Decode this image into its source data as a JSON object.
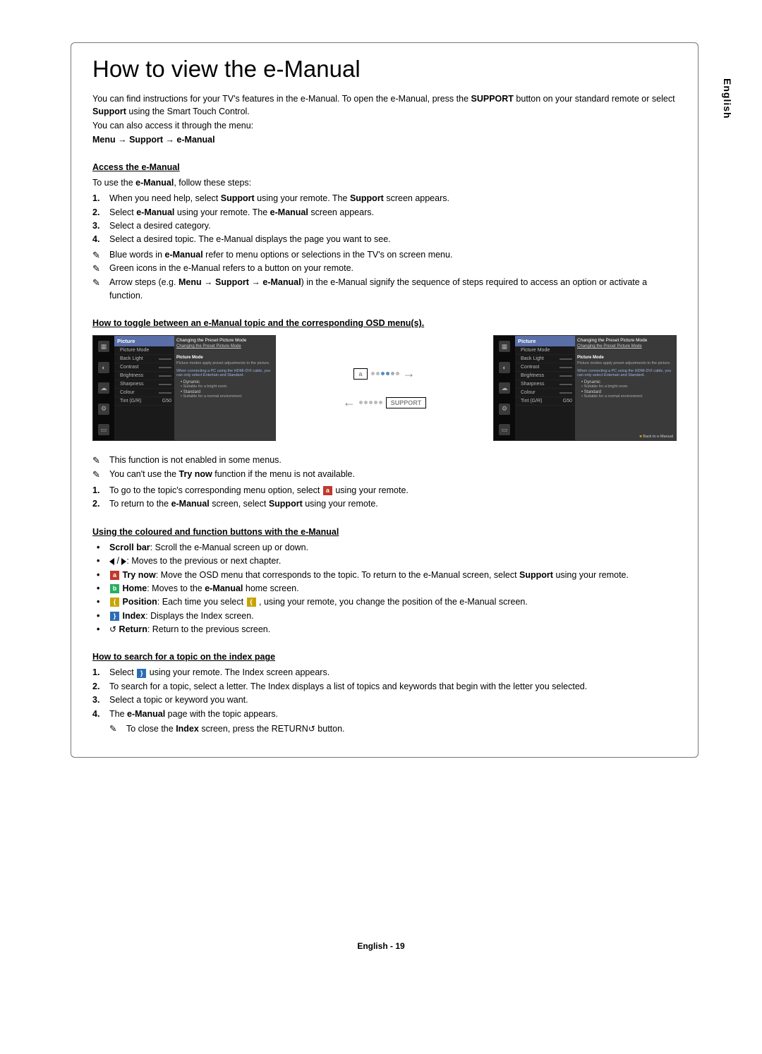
{
  "side_language": "English",
  "title": "How to view the e-Manual",
  "intro": {
    "p1a": "You can find instructions for your TV's features in the e-Manual. To open the e-Manual, press the ",
    "p1b": "SUPPORT",
    "p1c": " button on your standard remote or select ",
    "p1d": "Support",
    "p1e": " using the Smart Touch Control.",
    "p2": "You can also access it through the menu:",
    "menu_path": "Menu → Support → e-Manual"
  },
  "access": {
    "heading": "Access the e-Manual",
    "lead_a": "To use the ",
    "lead_b": "e-Manual",
    "lead_c": ", follow these steps:",
    "steps": [
      {
        "n": "1.",
        "t": "When you need help, select ",
        "b1": "Support",
        "t2": " using your remote. The ",
        "b2": "Support",
        "t3": " screen appears."
      },
      {
        "n": "2.",
        "t": "Select ",
        "b1": "e-Manual",
        "t2": " using your remote. The ",
        "b2": "e-Manual",
        "t3": " screen appears."
      },
      {
        "n": "3.",
        "t": "Select a desired category.",
        "b1": "",
        "t2": "",
        "b2": "",
        "t3": ""
      },
      {
        "n": "4.",
        "t": "Select a desired topic. The e-Manual displays the page you want to see.",
        "b1": "",
        "t2": "",
        "b2": "",
        "t3": ""
      }
    ],
    "notes": [
      {
        "pre": "Blue words in ",
        "b": "e-Manual",
        "post": " refer to menu options or selections in the TV's on screen menu."
      },
      {
        "pre": "Green icons in the e-Manual refers to a button on your remote.",
        "b": "",
        "post": ""
      },
      {
        "pre": "Arrow steps (e.g. ",
        "b": "Menu → Support → e-Manual",
        "post": ") in the e-Manual signify the sequence of steps required to access an option or activate a function."
      }
    ]
  },
  "toggle": {
    "heading": "How to toggle between an e-Manual topic and the corresponding OSD menu(s)."
  },
  "osd": {
    "header_title": "Changing the Preset Picture Mode",
    "link_text": "Changing the Preset Picture Mode",
    "menu_header": "Picture",
    "menu_items": [
      "Picture Mode",
      "Back Light",
      "Contrast",
      "Brightness",
      "Sharpness",
      "Colour",
      "Tint (G/R)"
    ],
    "tint_val": "G50",
    "content_sub": "Picture Mode",
    "content_txt1": "Picture modes apply preset adjustments to the picture.",
    "content_note": "When connecting a PC using the HDMI-DVI cable, you can only select Entertain and Standard.",
    "bullets_left": [
      "Dynamic",
      "Suitable for a bright room.",
      "Standard",
      "Suitable for a normal environment."
    ],
    "back_link": "Back to e-Manual",
    "btn_a": "a",
    "btn_support": "SUPPORT"
  },
  "toggle_notes": {
    "n1": "This function is not enabled in some menus.",
    "n2a": "You can't use the ",
    "n2b": "Try now",
    "n2c": " function if the menu is not available.",
    "s1a": "To go to the topic's corresponding menu option, select ",
    "s1b": " using your remote.",
    "s2a": "To return to the ",
    "s2b": "e-Manual",
    "s2c": " screen, select ",
    "s2d": "Support",
    "s2e": " using your remote."
  },
  "coloured": {
    "heading": "Using the coloured and function buttons with the e-Manual",
    "items": {
      "scroll_b": "Scroll bar",
      "scroll_t": ": Scroll the e-Manual screen up or down.",
      "arrows_t": ": Moves to the previous or next chapter.",
      "try_b": "Try now",
      "try_t": ": Move the OSD menu that corresponds to the topic. To return to the e-Manual screen, select ",
      "try_b2": "Support",
      "try_t2": " using your remote.",
      "home_b": "Home",
      "home_t": ": Moves to the ",
      "home_b2": "e-Manual",
      "home_t2": " home screen.",
      "pos_b": "Position",
      "pos_t": ": Each time you select ",
      "pos_t2": " , using your remote, you change the position of the e-Manual screen.",
      "idx_b": "Index",
      "idx_t": ": Displays the Index screen.",
      "ret_b": "Return",
      "ret_t": ": Return to the previous screen."
    }
  },
  "search": {
    "heading": "How to search for a topic on the index page",
    "s1a": "Select ",
    "s1b": " using your remote. The Index screen appears.",
    "s2": "To search for a topic, select a letter. The Index displays a list of topics and keywords that begin with the letter you selected.",
    "s3": "Select a topic or keyword you want.",
    "s4a": "The ",
    "s4b": "e-Manual",
    "s4c": " page with the topic appears.",
    "note_a": "To close the ",
    "note_b": "Index",
    "note_c": " screen, press the RETURN",
    "note_d": " button."
  },
  "footer": "English - 19"
}
